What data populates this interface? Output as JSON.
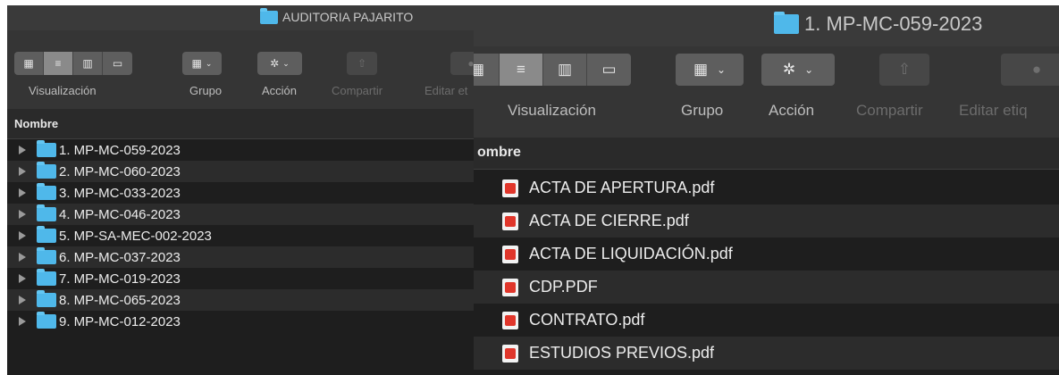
{
  "left_window": {
    "title": "AUDITORIA PAJARITO",
    "toolbar": {
      "view_label": "Visualización",
      "group_label": "Grupo",
      "action_label": "Acción",
      "share_label": "Compartir",
      "tags_label": "Editar et"
    },
    "column_header": "Nombre",
    "folders": [
      "1. MP-MC-059-2023",
      "2. MP-MC-060-2023",
      "3. MP-MC-033-2023",
      "4. MP-MC-046-2023",
      "5. MP-SA-MEC-002-2023",
      "6. MP-MC-037-2023",
      "7. MP-MC-019-2023",
      "8. MP-MC-065-2023",
      "9. MP-MC-012-2023"
    ]
  },
  "right_window": {
    "title": "1. MP-MC-059-2023",
    "toolbar": {
      "view_label": "Visualización",
      "group_label": "Grupo",
      "action_label": "Acción",
      "share_label": "Compartir",
      "tags_label": "Editar etiq"
    },
    "column_header": "ombre",
    "files": [
      "ACTA DE APERTURA.pdf",
      "ACTA DE CIERRE.pdf",
      "ACTA DE LIQUIDACIÓN.pdf",
      "CDP.PDF",
      "CONTRATO.pdf",
      "ESTUDIOS PREVIOS.pdf"
    ]
  },
  "icons": {
    "view_icon": "icon-view-grid",
    "list_view_icon": "list-view-icon",
    "column_view_icon": "column-view-icon",
    "gallery_view_icon": "gallery-view-icon",
    "group_icon": "group-icon",
    "action_icon": "gear-icon",
    "share_icon": "share-icon",
    "tag_icon": "tag-icon",
    "folder_icon": "folder-icon",
    "pdf_icon": "pdf-icon",
    "disclosure_icon": "disclosure-triangle-icon"
  },
  "colors": {
    "window_bg": "#1e1e1e",
    "row_alt_bg": "#2c2c2c",
    "toolbar_bg": "#353535",
    "folder_blue": "#4fb8ea",
    "pdf_red": "#e0362b"
  }
}
